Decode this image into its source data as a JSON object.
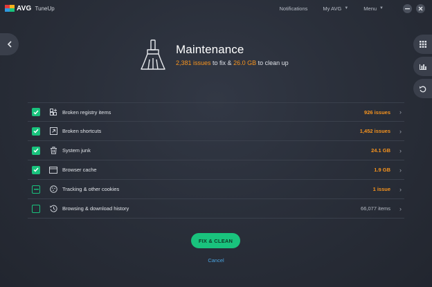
{
  "titlebar": {
    "brand": "AVG",
    "product": "TuneUp",
    "notifications": "Notifications",
    "my_avg": "My AVG",
    "menu": "Menu",
    "minimize_icon": "minus-icon",
    "close_icon": "close-icon"
  },
  "header": {
    "title": "Maintenance",
    "issues_count": "2,381 issues",
    "to_fix": " to fix & ",
    "size": "26.0 GB",
    "to_clean": " to clean up"
  },
  "items": [
    {
      "label": "Broken registry items",
      "value": "926 issues",
      "state": "checked",
      "icon": "registry-icon",
      "value_color": "#f7941e"
    },
    {
      "label": "Broken shortcuts",
      "value": "1,452 issues",
      "state": "checked",
      "icon": "shortcut-icon",
      "value_color": "#f7941e"
    },
    {
      "label": "System junk",
      "value": "24.1 GB",
      "state": "checked",
      "icon": "trash-icon",
      "value_color": "#f7941e"
    },
    {
      "label": "Browser cache",
      "value": "1.9 GB",
      "state": "checked",
      "icon": "browser-icon",
      "value_color": "#f7941e"
    },
    {
      "label": "Tracking & other cookies",
      "value": "1 issue",
      "state": "partial",
      "icon": "cookie-icon",
      "value_color": "#f7941e"
    },
    {
      "label": "Browsing & download history",
      "value": "66,077 items",
      "state": "unchecked",
      "icon": "history-icon",
      "value_color": "#b8bdc6"
    }
  ],
  "actions": {
    "fix_clean": "FIX & CLEAN",
    "cancel": "Cancel"
  },
  "colors": {
    "accent": "#19c37d",
    "warning": "#f7941e",
    "link": "#4aa3df"
  }
}
